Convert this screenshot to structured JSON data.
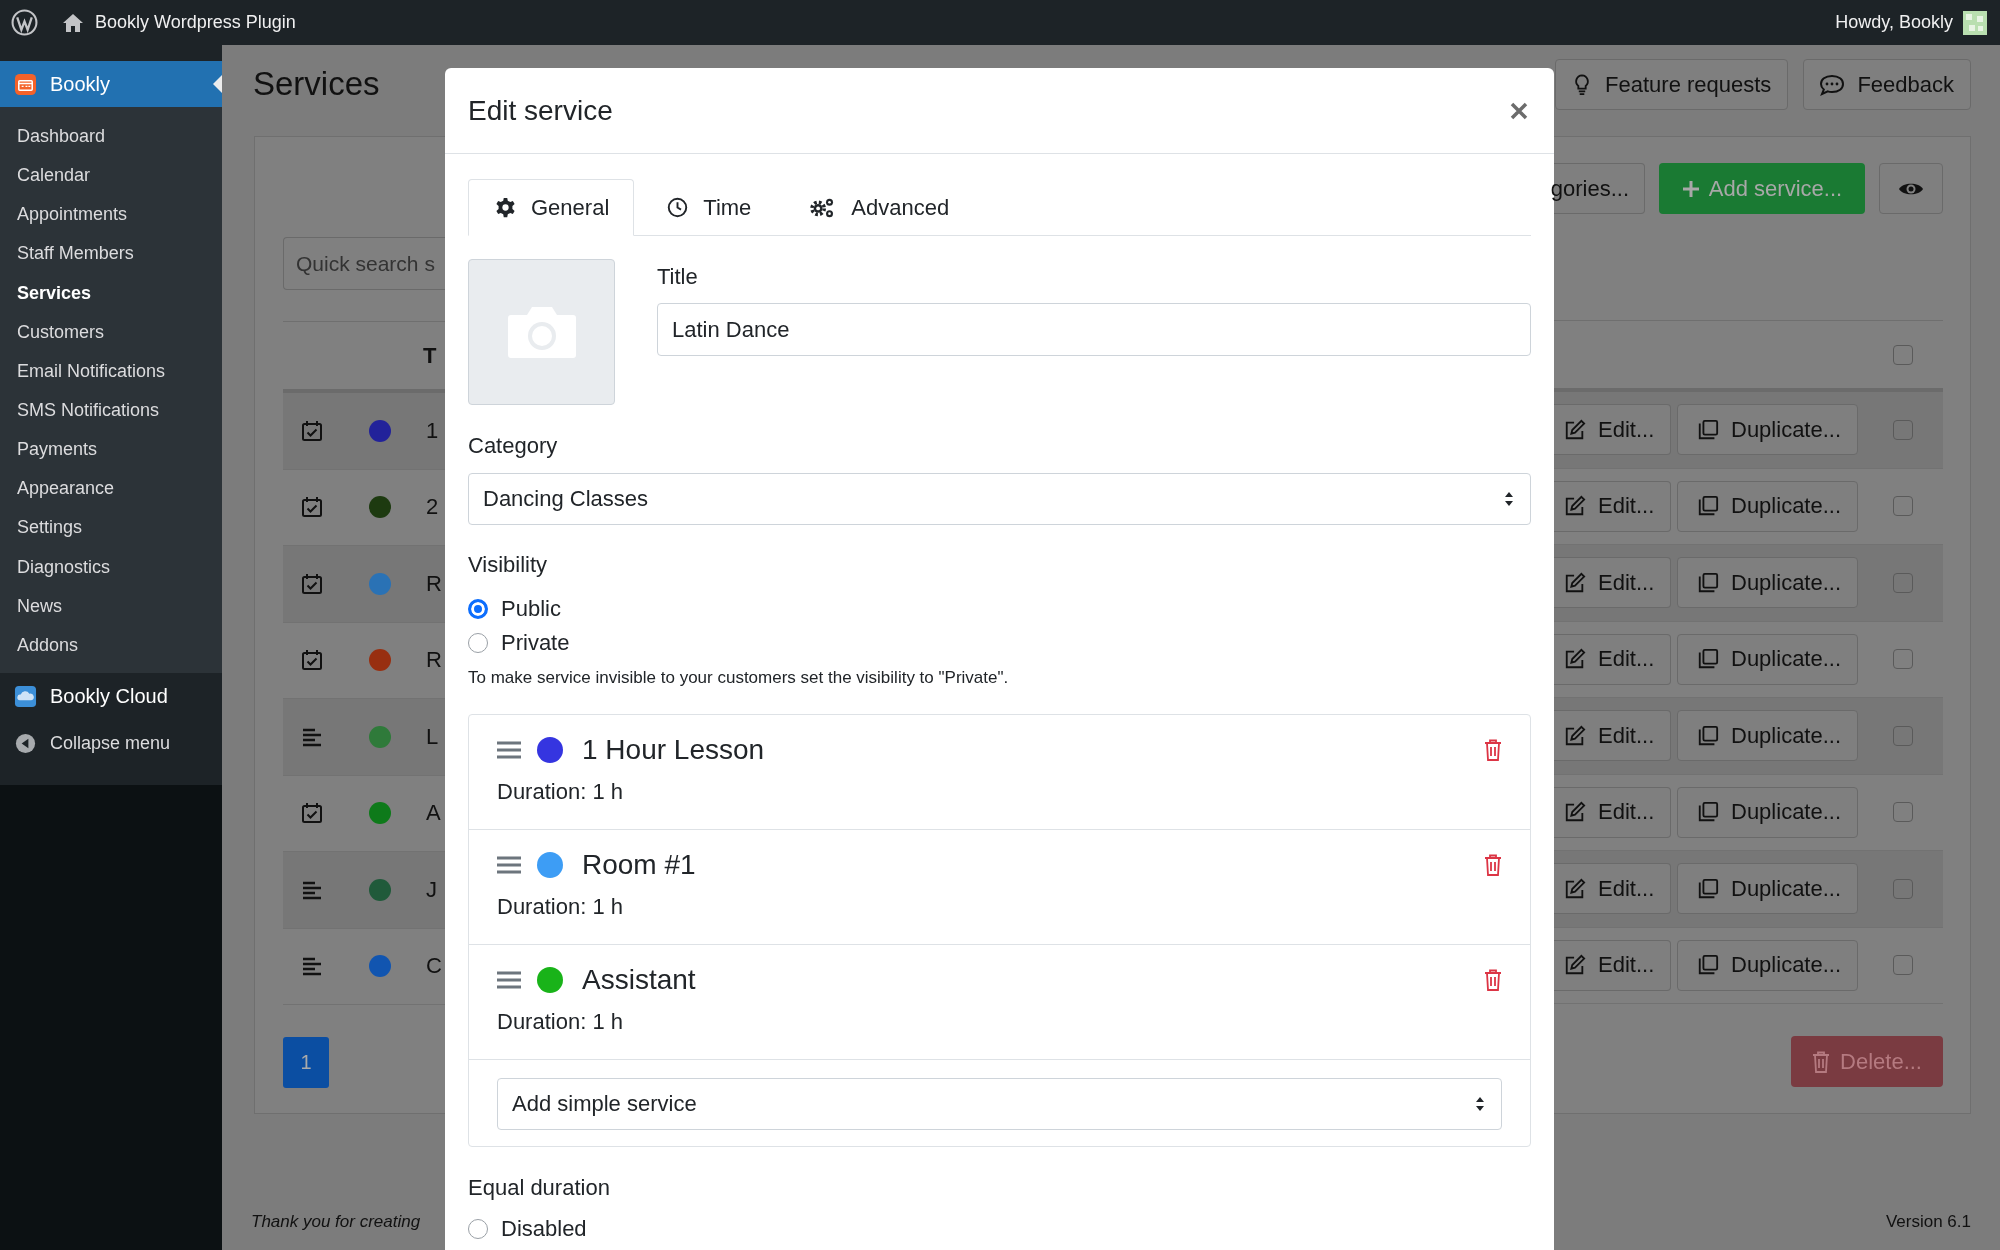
{
  "topbar": {
    "site_name": "Bookly Wordpress Plugin",
    "greeting": "Howdy, Bookly"
  },
  "sidebar": {
    "header": "Bookly",
    "items": [
      {
        "label": "Dashboard",
        "selected": false
      },
      {
        "label": "Calendar",
        "selected": false
      },
      {
        "label": "Appointments",
        "selected": false
      },
      {
        "label": "Staff Members",
        "selected": false
      },
      {
        "label": "Services",
        "selected": true
      },
      {
        "label": "Customers",
        "selected": false
      },
      {
        "label": "Email Notifications",
        "selected": false
      },
      {
        "label": "SMS Notifications",
        "selected": false
      },
      {
        "label": "Payments",
        "selected": false
      },
      {
        "label": "Appearance",
        "selected": false
      },
      {
        "label": "Settings",
        "selected": false
      },
      {
        "label": "Diagnostics",
        "selected": false
      },
      {
        "label": "News",
        "selected": false
      },
      {
        "label": "Addons",
        "selected": false
      }
    ],
    "cloud": "Bookly Cloud",
    "collapse": "Collapse menu"
  },
  "page": {
    "title": "Services",
    "header_buttons": [
      {
        "label": "Feature requests",
        "kind": "bulb"
      },
      {
        "label": "Feedback",
        "kind": "chat"
      }
    ],
    "search": {
      "placeholder": "Quick search s"
    },
    "categories_button": "gories...",
    "add_button": "Add service...",
    "table": {
      "column_1": "T",
      "select_all": {
        "checked": false
      },
      "rows": [
        {
          "kind": "calendar",
          "color": "#22229a",
          "title": "1",
          "edit": "Edit...",
          "duplicate": "Duplicate...",
          "checked": false
        },
        {
          "kind": "calendar",
          "color": "#1d3a10",
          "title": "2",
          "edit": "Edit...",
          "duplicate": "Duplicate...",
          "checked": false
        },
        {
          "kind": "calendar",
          "color": "#2a72b5",
          "title": "R",
          "edit": "Edit...",
          "duplicate": "Duplicate...",
          "checked": false
        },
        {
          "kind": "calendar",
          "color": "#982f10",
          "title": "R",
          "edit": "Edit...",
          "duplicate": "Duplicate...",
          "checked": false
        },
        {
          "kind": "list",
          "color": "#2f7a3a",
          "title": "L",
          "edit": "Edit...",
          "duplicate": "Duplicate...",
          "checked": false
        },
        {
          "kind": "calendar",
          "color": "#0e7a1a",
          "title": "A",
          "edit": "Edit...",
          "duplicate": "Duplicate...",
          "checked": false
        },
        {
          "kind": "list",
          "color": "#205a3a",
          "title": "J",
          "edit": "Edit...",
          "duplicate": "Duplicate...",
          "checked": false
        },
        {
          "kind": "list",
          "color": "#1155b0",
          "title": "C",
          "edit": "Edit...",
          "duplicate": "Duplicate...",
          "checked": false
        }
      ]
    },
    "pagination": [
      {
        "label": "1",
        "selected": true
      }
    ],
    "delete_button": "Delete..."
  },
  "footer": {
    "thanks": "Thank you for creating",
    "version": "Version 6.1"
  },
  "modal": {
    "title": "Edit service",
    "tabs": [
      {
        "label": "General",
        "kind": "gear",
        "selected": true
      },
      {
        "label": "Time",
        "kind": "clock",
        "selected": false
      },
      {
        "label": "Advanced",
        "kind": "gears",
        "selected": false
      }
    ],
    "title_field": {
      "label": "Title",
      "value": "Latin Dance"
    },
    "category": {
      "label": "Category",
      "value": "Dancing Classes"
    },
    "visibility": {
      "label": "Visibility",
      "options": [
        {
          "label": "Public",
          "selected": true
        },
        {
          "label": "Private",
          "selected": false
        }
      ],
      "help": "To make service invisible to your customers set the visibility to \"Private\"."
    },
    "sub_services": [
      {
        "title": "1 Hour Lesson",
        "color": "#3535e0",
        "duration": "Duration: 1 h"
      },
      {
        "title": "Room #1",
        "color": "#3d9df5",
        "duration": "Duration: 1 h"
      },
      {
        "title": "Assistant",
        "color": "#19b319",
        "duration": "Duration: 1 h"
      }
    ],
    "add_select": {
      "value": "Add simple service"
    },
    "equal_duration": {
      "label": "Equal duration",
      "options": [
        {
          "label": "Disabled",
          "selected": false
        }
      ]
    }
  }
}
